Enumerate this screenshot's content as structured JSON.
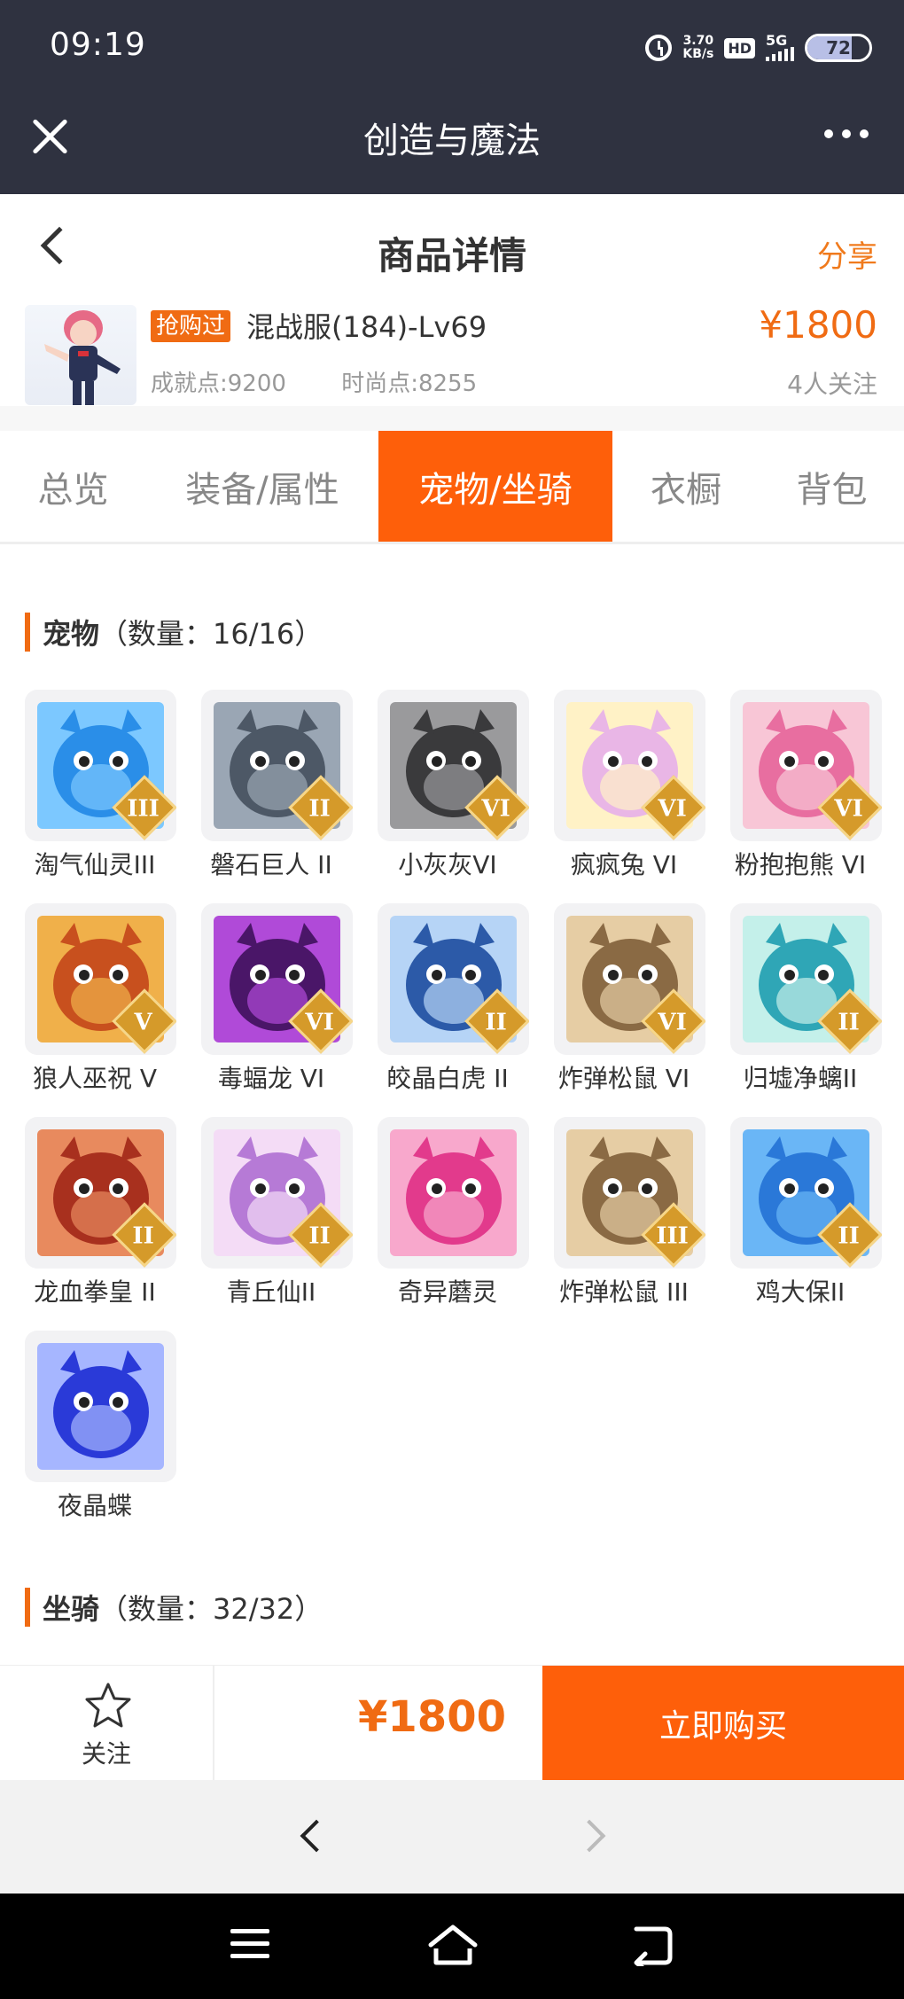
{
  "status_bar": {
    "time": "09:19",
    "net_speed_value": "3.70",
    "net_speed_unit": "KB/s",
    "hd": "HD",
    "signal": "5G",
    "battery": "72",
    "battery_level_percent": 72
  },
  "title_bar": {
    "title": "创造与魔法",
    "close_icon": "close-icon",
    "more_icon": "more-dots-icon"
  },
  "header": {
    "title": "商品详情",
    "share": "分享"
  },
  "product": {
    "badge": "抢购过",
    "server": "混战服(184)-Lv69",
    "price": "¥1800",
    "achievement": "成就点:9200",
    "fashion": "时尚点:8255",
    "followers": "4人关注"
  },
  "tabs": [
    {
      "label": "总览",
      "active": false
    },
    {
      "label": "装备/属性",
      "active": false
    },
    {
      "label": "宠物/坐骑",
      "active": true
    },
    {
      "label": "衣橱",
      "active": false
    },
    {
      "label": "背包",
      "active": false
    }
  ],
  "pets_section": {
    "title": "宠物",
    "count": "（数量：16/16）",
    "items": [
      {
        "name": "淘气仙灵III",
        "roman": "III",
        "c1": "#2a8ee8",
        "c2": "#7cc8ff"
      },
      {
        "name": "磐石巨人 II",
        "roman": "II",
        "c1": "#4d5866",
        "c2": "#9aa6b4"
      },
      {
        "name": "小灰灰VI",
        "roman": "VI",
        "c1": "#3a3a3c",
        "c2": "#9a9a9c"
      },
      {
        "name": "疯疯兔 VI",
        "roman": "VI",
        "c1": "#e9b6e6",
        "c2": "#fff2c6"
      },
      {
        "name": "粉抱抱熊 VI",
        "roman": "VI",
        "c1": "#e86ea0",
        "c2": "#f8c6d6"
      },
      {
        "name": "狼人巫祝 V",
        "roman": "V",
        "c1": "#c8501e",
        "c2": "#f0b04a"
      },
      {
        "name": "毒蝠龙 VI",
        "roman": "VI",
        "c1": "#4a1668",
        "c2": "#b04ad8"
      },
      {
        "name": "皎晶白虎 II",
        "roman": "II",
        "c1": "#2c5aa8",
        "c2": "#b6d4f6"
      },
      {
        "name": "炸弹松鼠 VI",
        "roman": "VI",
        "c1": "#8a6a44",
        "c2": "#e6cda4"
      },
      {
        "name": "归墟净螭II",
        "roman": "II",
        "c1": "#2fa6b6",
        "c2": "#c4f0ea"
      },
      {
        "name": "龙血拳皇 II",
        "roman": "II",
        "c1": "#a8301e",
        "c2": "#e88a5e"
      },
      {
        "name": "青丘仙II",
        "roman": "II",
        "c1": "#b67ad6",
        "c2": "#f4dcf6"
      },
      {
        "name": "奇异蘑灵",
        "roman": "",
        "c1": "#e23a8c",
        "c2": "#f8a8cc"
      },
      {
        "name": "炸弹松鼠 III",
        "roman": "III",
        "c1": "#8a6a44",
        "c2": "#e6cda4"
      },
      {
        "name": "鸡大保II",
        "roman": "II",
        "c1": "#2a78d8",
        "c2": "#6ab6f6"
      },
      {
        "name": "夜晶蝶",
        "roman": "",
        "c1": "#2a3ad8",
        "c2": "#a6b6ff"
      }
    ]
  },
  "mounts_section": {
    "title": "坐骑",
    "count": "（数量：32/32）"
  },
  "buy_bar": {
    "follow_label": "关注",
    "price": "¥1800",
    "buy_label": "立即购买"
  },
  "colors": {
    "accent": "#fe5f0a",
    "dark_header": "#2f3240"
  }
}
